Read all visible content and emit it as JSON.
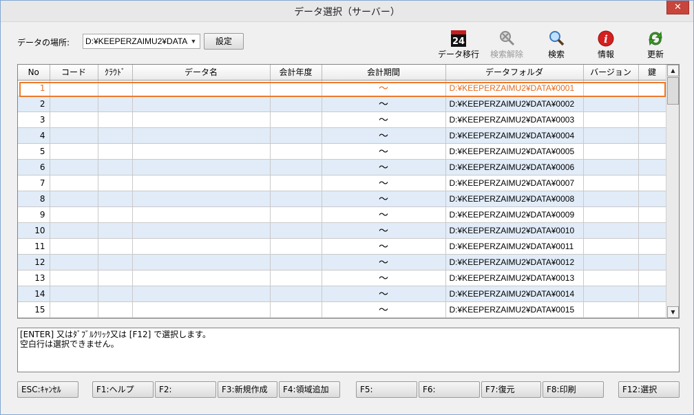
{
  "window": {
    "title": "データ選択（サーバー）",
    "close_glyph": "✕"
  },
  "location": {
    "label": "データの場所:",
    "value": "D:¥KEEPERZAIMU2¥DATA",
    "set_button": "設定"
  },
  "toolbar": [
    {
      "label": "データ移行",
      "icon": "data-migrate-24-icon",
      "badge": "24",
      "enabled": true
    },
    {
      "label": "検索解除",
      "icon": "search-clear-icon",
      "enabled": false
    },
    {
      "label": "検索",
      "icon": "search-icon",
      "enabled": true
    },
    {
      "label": "情報",
      "icon": "info-icon",
      "enabled": true
    },
    {
      "label": "更新",
      "icon": "refresh-icon",
      "enabled": true
    }
  ],
  "grid": {
    "columns": [
      "No",
      "コード",
      "ｸﾗｳﾄﾞ",
      "データ名",
      "会計年度",
      "会計期間",
      "データフォルダ",
      "バージョン",
      "鍵"
    ],
    "rows": [
      {
        "no": "1",
        "period": "～",
        "folder": "D:¥KEEPERZAIMU2¥DATA¥0001"
      },
      {
        "no": "2",
        "period": "～",
        "folder": "D:¥KEEPERZAIMU2¥DATA¥0002"
      },
      {
        "no": "3",
        "period": "～",
        "folder": "D:¥KEEPERZAIMU2¥DATA¥0003"
      },
      {
        "no": "4",
        "period": "～",
        "folder": "D:¥KEEPERZAIMU2¥DATA¥0004"
      },
      {
        "no": "5",
        "period": "～",
        "folder": "D:¥KEEPERZAIMU2¥DATA¥0005"
      },
      {
        "no": "6",
        "period": "～",
        "folder": "D:¥KEEPERZAIMU2¥DATA¥0006"
      },
      {
        "no": "7",
        "period": "～",
        "folder": "D:¥KEEPERZAIMU2¥DATA¥0007"
      },
      {
        "no": "8",
        "period": "～",
        "folder": "D:¥KEEPERZAIMU2¥DATA¥0008"
      },
      {
        "no": "9",
        "period": "～",
        "folder": "D:¥KEEPERZAIMU2¥DATA¥0009"
      },
      {
        "no": "10",
        "period": "～",
        "folder": "D:¥KEEPERZAIMU2¥DATA¥0010"
      },
      {
        "no": "11",
        "period": "～",
        "folder": "D:¥KEEPERZAIMU2¥DATA¥0011"
      },
      {
        "no": "12",
        "period": "～",
        "folder": "D:¥KEEPERZAIMU2¥DATA¥0012"
      },
      {
        "no": "13",
        "period": "～",
        "folder": "D:¥KEEPERZAIMU2¥DATA¥0013"
      },
      {
        "no": "14",
        "period": "～",
        "folder": "D:¥KEEPERZAIMU2¥DATA¥0014"
      },
      {
        "no": "15",
        "period": "～",
        "folder": "D:¥KEEPERZAIMU2¥DATA¥0015"
      }
    ],
    "selected_row": "1"
  },
  "message": {
    "line1": "[ENTER] 又はﾀﾞﾌﾞﾙｸﾘｯｸ又は [F12] で選択します。",
    "line2": "空白行は選択できません。"
  },
  "fkeys": [
    {
      "label": "ESC:ｷｬﾝｾﾙ"
    },
    {
      "label": "F1:ヘルプ"
    },
    {
      "label": "F2:"
    },
    {
      "label": "F3:新規作成"
    },
    {
      "label": "F4:領域追加"
    },
    {
      "label": "F5:"
    },
    {
      "label": "F6:"
    },
    {
      "label": "F7:復元"
    },
    {
      "label": "F8:印刷"
    },
    {
      "label": "F12:選択"
    }
  ],
  "colors": {
    "selection": "#ee7a2b",
    "alt_row": "#e1ecf8",
    "close": "#c7453b"
  }
}
